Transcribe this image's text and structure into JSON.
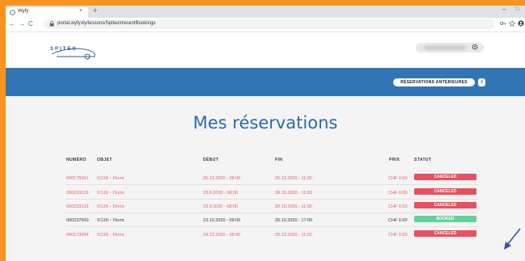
{
  "browser": {
    "tab_title": "Wyfy",
    "tab_close": "×",
    "new_tab": "+",
    "nav_back": "←",
    "nav_forward": "→",
    "nav_reload": "C",
    "lock": "🔒",
    "url": "portal.wyfy.by/lessons/Spitex#recentBookings",
    "window_min": "–",
    "window_max": "□"
  },
  "header": {
    "logo_text": "SPITEX",
    "user_menu_icon": "gear-icon"
  },
  "banner": {
    "previous_reservations_label": "RÉSERVATIONS ANTÉRIEURES",
    "previous_reservations_icon": "≡"
  },
  "main": {
    "title": "Mes réservations",
    "columns": {
      "numero": "NUMÉRO",
      "objet": "OBJET",
      "debut": "DÉBUT",
      "fin": "FIN",
      "prix": "PRIX",
      "statut": "STATUT"
    },
    "rows": [
      {
        "numero": "000175561",
        "objet": "9326 - Horn",
        "debut": "25.12.2020 - 08:00",
        "fin": "25.12.2020 - 11:00",
        "prix": "CHF 0.00",
        "statut": "CANCELED"
      },
      {
        "numero": "000223126",
        "objet": "9326 - Horn",
        "debut": "23.9.2020 - 08:00",
        "fin": "30.10.2020 - 11:00",
        "prix": "CHF 0.00",
        "statut": "CANCELED"
      },
      {
        "numero": "000223133",
        "objet": "9326 - Horn",
        "debut": "23.9.2020 - 08:00",
        "fin": "30.10.2020 - 11:00",
        "prix": "CHF 0.00",
        "statut": "CANCELED"
      },
      {
        "numero": "000237600",
        "objet": "9326 - Horn",
        "debut": "23.10.2020 - 09:00",
        "fin": "26.10.2020 - 17:00",
        "prix": "CHF 0.00",
        "statut": "BOOKED"
      },
      {
        "numero": "000173004",
        "objet": "9326 - Horn",
        "debut": "24.12.2020 - 08:00",
        "fin": "25.12.2020 - 11:00",
        "prix": "CHF 0.00",
        "statut": "CANCELED"
      }
    ]
  },
  "colors": {
    "frame": "#f7941d",
    "banner": "#3275b4",
    "title": "#2c6aa8",
    "canceled": "#e8505f",
    "booked": "#5fd39a",
    "canceled_text": "#e05a6a"
  }
}
